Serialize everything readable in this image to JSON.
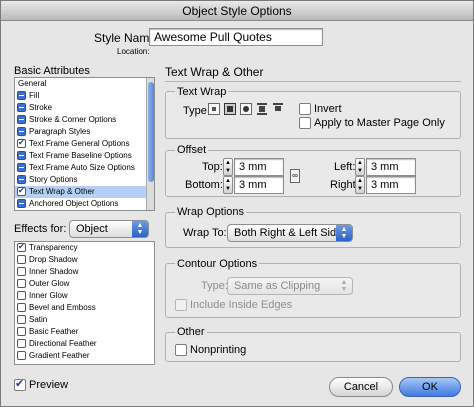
{
  "window": {
    "title": "Object Style Options"
  },
  "style_name": {
    "label": "Style Name:",
    "value": "Awesome Pull Quotes",
    "location_label": "Location:"
  },
  "basic_attributes": {
    "title": "Basic Attributes",
    "items": [
      {
        "label": "General",
        "state": "none"
      },
      {
        "label": "Fill",
        "state": "minus"
      },
      {
        "label": "Stroke",
        "state": "minus"
      },
      {
        "label": "Stroke & Corner Options",
        "state": "minus"
      },
      {
        "label": "Paragraph Styles",
        "state": "minus"
      },
      {
        "label": "Text Frame General Options",
        "state": "checked"
      },
      {
        "label": "Text Frame Baseline Options",
        "state": "minus"
      },
      {
        "label": "Text Frame Auto Size Options",
        "state": "minus"
      },
      {
        "label": "Story Options",
        "state": "minus"
      },
      {
        "label": "Text Wrap & Other",
        "state": "checked",
        "selected": true
      },
      {
        "label": "Anchored Object Options",
        "state": "minus"
      }
    ]
  },
  "effects": {
    "label": "Effects for:",
    "target": "Object",
    "items": [
      {
        "label": "Transparency",
        "checked": true
      },
      {
        "label": "Drop Shadow",
        "checked": false
      },
      {
        "label": "Inner Shadow",
        "checked": false
      },
      {
        "label": "Outer Glow",
        "checked": false
      },
      {
        "label": "Inner Glow",
        "checked": false
      },
      {
        "label": "Bevel and Emboss",
        "checked": false
      },
      {
        "label": "Satin",
        "checked": false
      },
      {
        "label": "Basic Feather",
        "checked": false
      },
      {
        "label": "Directional Feather",
        "checked": false
      },
      {
        "label": "Gradient Feather",
        "checked": false
      }
    ]
  },
  "panel": {
    "title": "Text Wrap & Other"
  },
  "text_wrap": {
    "title": "Text Wrap",
    "type_label": "Type",
    "invert_label": "Invert",
    "apply_master_label": "Apply to Master Page Only",
    "invert": false,
    "apply_master": false
  },
  "offset": {
    "title": "Offset",
    "top_label": "Top:",
    "top": "3 mm",
    "bottom_label": "Bottom:",
    "bottom": "3 mm",
    "left_label": "Left:",
    "left": "3 mm",
    "right_label": "Right:",
    "right": "3 mm"
  },
  "wrap_options": {
    "title": "Wrap Options",
    "wrap_to_label": "Wrap To:",
    "wrap_to": "Both Right & Left Sides"
  },
  "contour_options": {
    "title": "Contour Options",
    "type_label": "Type:",
    "type": "Same as Clipping",
    "include_inside_label": "Include Inside Edges"
  },
  "other": {
    "title": "Other",
    "nonprinting_label": "Nonprinting",
    "nonprinting": false
  },
  "footer": {
    "preview_label": "Preview",
    "preview": true,
    "cancel_label": "Cancel",
    "ok_label": "OK"
  }
}
